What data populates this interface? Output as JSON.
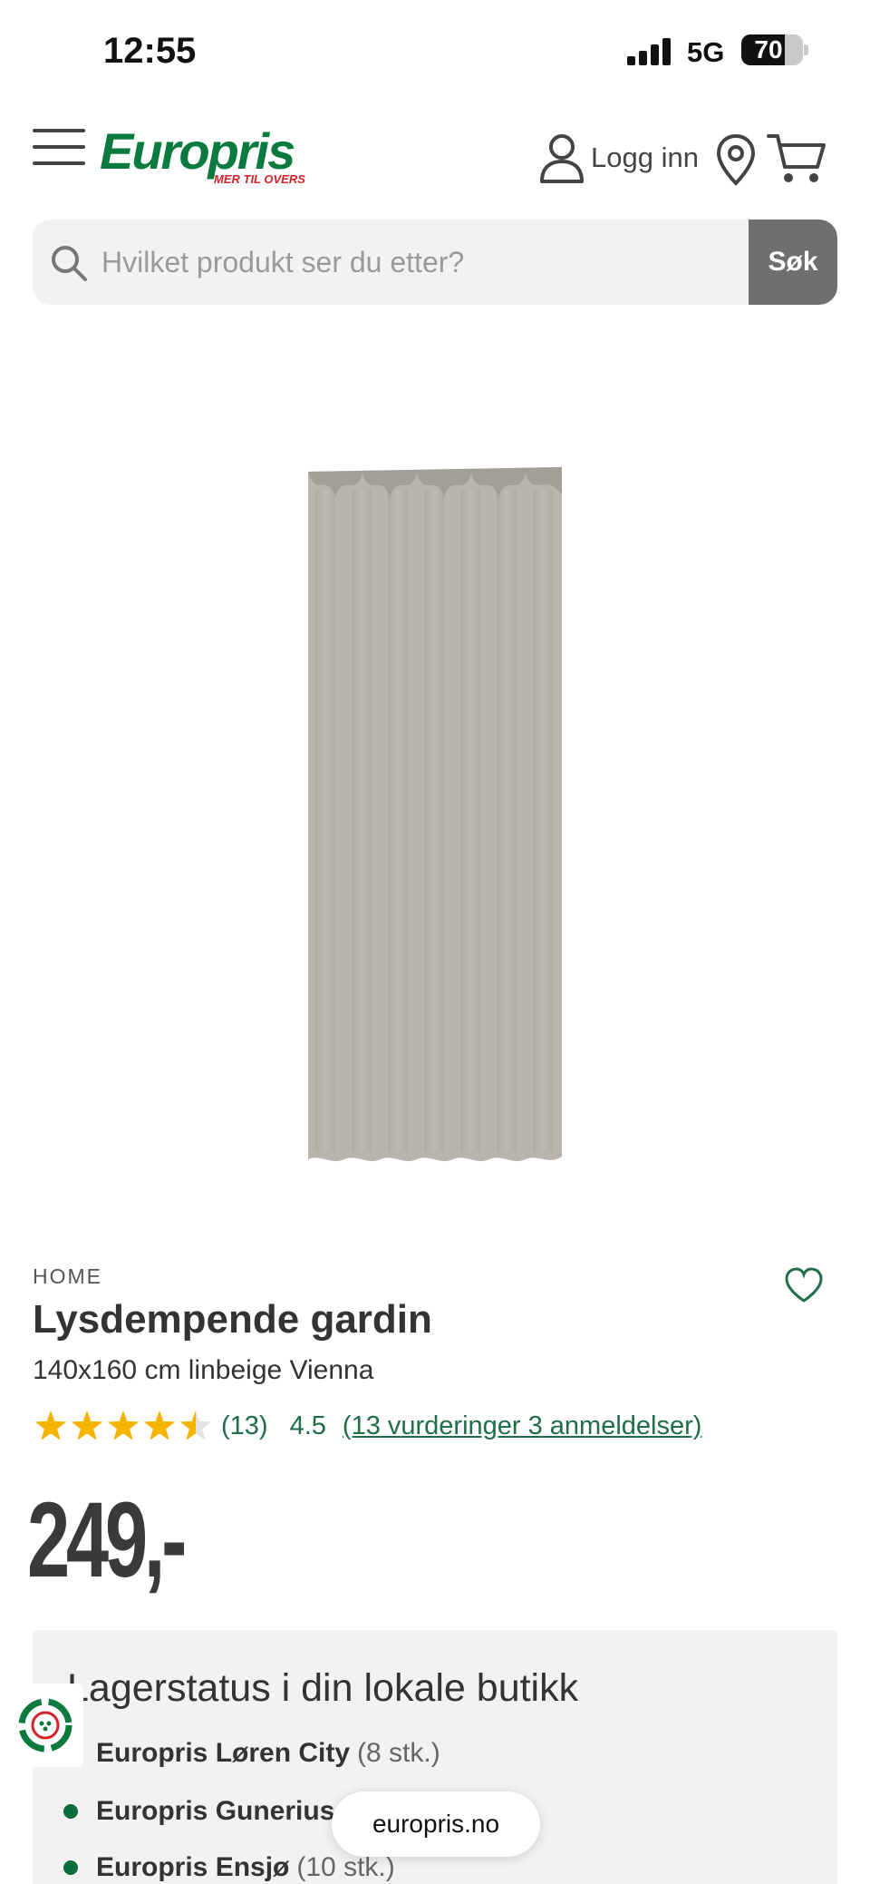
{
  "status_bar": {
    "time": "12:55",
    "network": "5G",
    "battery": "70",
    "battery_level": 0.7
  },
  "header": {
    "logo_text": "Europris",
    "logo_tagline": "MER TIL OVERS",
    "login_label": "Logg inn"
  },
  "search": {
    "placeholder": "Hvilket produkt ser du etter?",
    "button_label": "Søk"
  },
  "product": {
    "brand": "HOME",
    "title": "Lysdempende gardin",
    "subtitle": "140x160 cm linbeige Vienna",
    "rating_stars": 4.5,
    "rating_count": "(13)",
    "rating_value": "4.5",
    "reviews_link": "(13 vurderinger 3 anmeldelser)",
    "price": "249,-",
    "image_color": "#b9b5ae"
  },
  "stock": {
    "title": "Lagerstatus i din lokale butikk",
    "stores": [
      {
        "name": "Europris Løren City",
        "qty": "(8 stk.)"
      },
      {
        "name": "Europris Gunerius C",
        "qty": ""
      },
      {
        "name": "Europris Ensjø",
        "qty": "(10 stk.)"
      }
    ]
  },
  "browser": {
    "url": "europris.no"
  },
  "colors": {
    "brand_green": "#0a7a3e",
    "brand_red": "#d2232a",
    "link_green": "#1f6e47",
    "star_yellow": "#f5b400"
  }
}
